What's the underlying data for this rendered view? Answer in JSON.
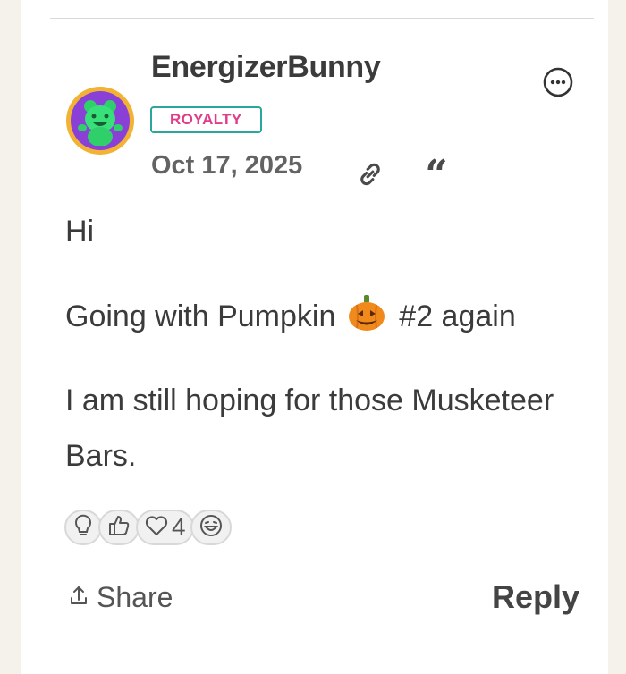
{
  "post": {
    "username": "EnergizerBunny",
    "badge": "ROYALTY",
    "date": "Oct 17, 2025",
    "paragraphs": {
      "p1": "Hi",
      "p2_before": "Going with Pumpkin",
      "p2_emoji": "jack-o-lantern",
      "p2_after": "#2 again",
      "p3": "I am still hoping for those Musketeer Bars."
    }
  },
  "reactions": [
    {
      "icon": "lightbulb-icon",
      "count": ""
    },
    {
      "icon": "thumbs-up-icon",
      "count": ""
    },
    {
      "icon": "heart-icon",
      "count": "4"
    },
    {
      "icon": "laughing-face-icon",
      "count": ""
    }
  ],
  "actions": {
    "share_label": "Share",
    "reply_label": "Reply"
  },
  "colors": {
    "badge_border": "#2aa69a",
    "badge_text": "#e03c8a",
    "avatar_ring": "#f2b233",
    "avatar_bg": "#8a3fd6"
  }
}
